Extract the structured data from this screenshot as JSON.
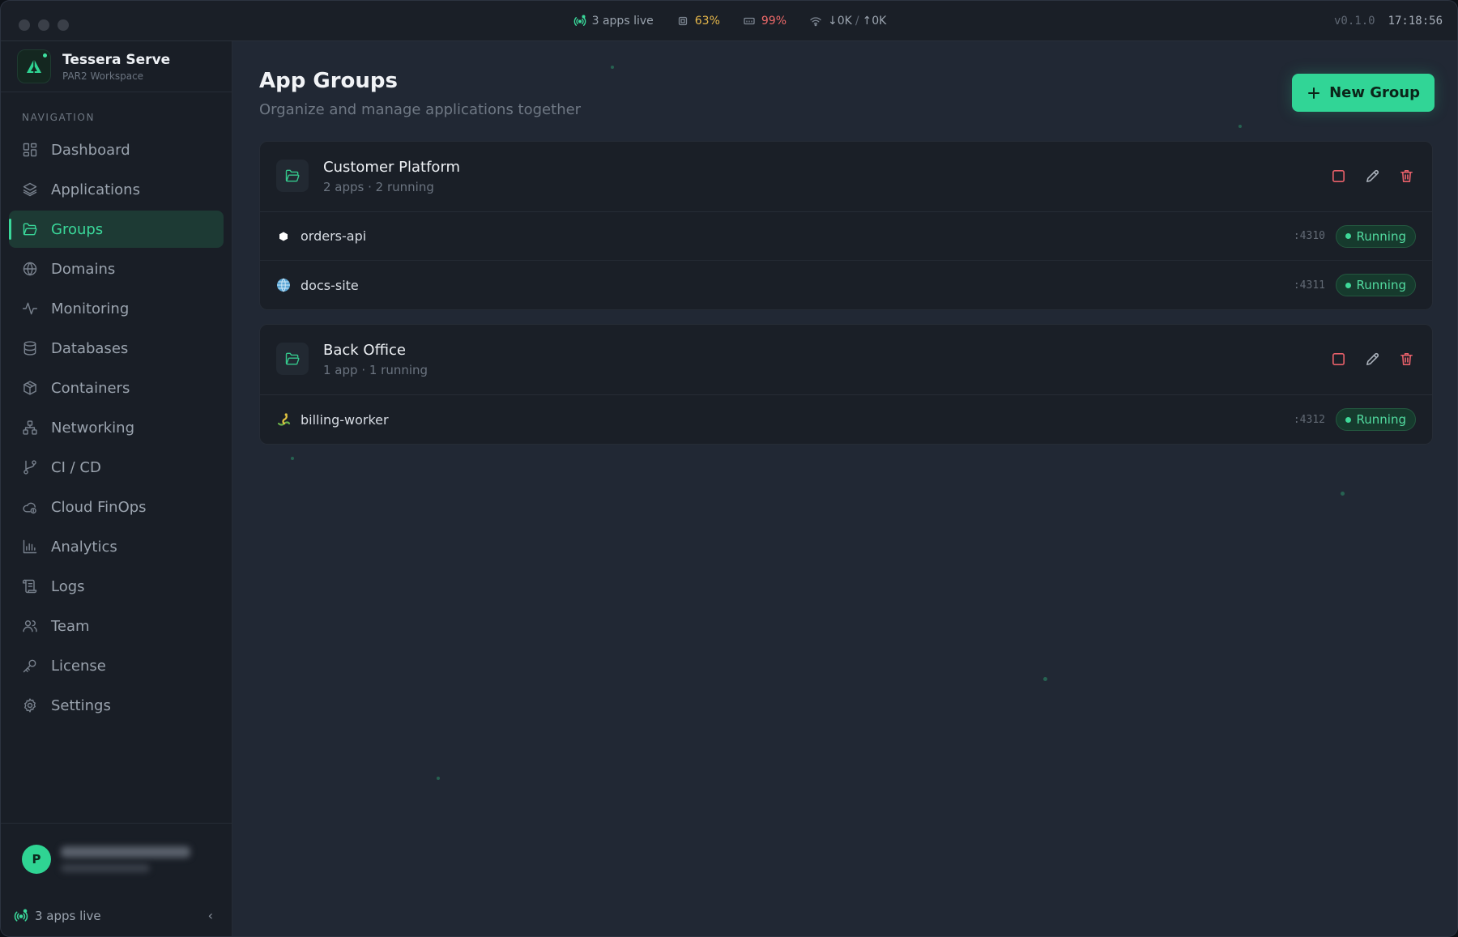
{
  "titlebar": {
    "apps_live": "3 apps live",
    "cpu": "63%",
    "mem": "99%",
    "net_down": "↓0K",
    "net_sep": "/",
    "net_up": "↑0K",
    "version": "v0.1.0",
    "clock": "17:18:56"
  },
  "brand": {
    "name": "Tessera Serve",
    "workspace": "PAR2 Workspace"
  },
  "sidebar": {
    "heading": "NAVIGATION",
    "items": [
      {
        "label": "Dashboard",
        "icon": "dashboard-icon"
      },
      {
        "label": "Applications",
        "icon": "layers-icon"
      },
      {
        "label": "Groups",
        "icon": "folder-open-icon",
        "active": true
      },
      {
        "label": "Domains",
        "icon": "globe-icon"
      },
      {
        "label": "Monitoring",
        "icon": "activity-icon"
      },
      {
        "label": "Databases",
        "icon": "database-icon"
      },
      {
        "label": "Containers",
        "icon": "box-icon"
      },
      {
        "label": "Networking",
        "icon": "network-icon"
      },
      {
        "label": "CI / CD",
        "icon": "git-branch-icon"
      },
      {
        "label": "Cloud FinOps",
        "icon": "cloud-cost-icon"
      },
      {
        "label": "Analytics",
        "icon": "bar-chart-icon"
      },
      {
        "label": "Logs",
        "icon": "scroll-icon"
      },
      {
        "label": "Team",
        "icon": "users-icon"
      },
      {
        "label": "License",
        "icon": "key-icon"
      },
      {
        "label": "Settings",
        "icon": "gear-icon"
      }
    ],
    "user_initial": "P",
    "footer_status": "3 apps live",
    "collapse_glyph": "‹"
  },
  "page": {
    "title": "App Groups",
    "subtitle": "Organize and manage applications together",
    "new_button": "New Group"
  },
  "groups": [
    {
      "name": "Customer Platform",
      "meta": "2 apps · 2 running",
      "apps": [
        {
          "name": "orders-api",
          "icon": "hexagon-icon",
          "port": ":4310",
          "status": "Running"
        },
        {
          "name": "docs-site",
          "icon": "globe-emoji-icon",
          "port": ":4311",
          "status": "Running"
        }
      ]
    },
    {
      "name": "Back Office",
      "meta": "1 app · 1 running",
      "apps": [
        {
          "name": "billing-worker",
          "icon": "python-snake-icon",
          "port": ":4312",
          "status": "Running"
        }
      ]
    }
  ],
  "colors": {
    "accent": "#31d596",
    "danger": "#e8606a",
    "warning": "#e7b84b",
    "background": "#212834",
    "sidebar": "#191e26"
  }
}
